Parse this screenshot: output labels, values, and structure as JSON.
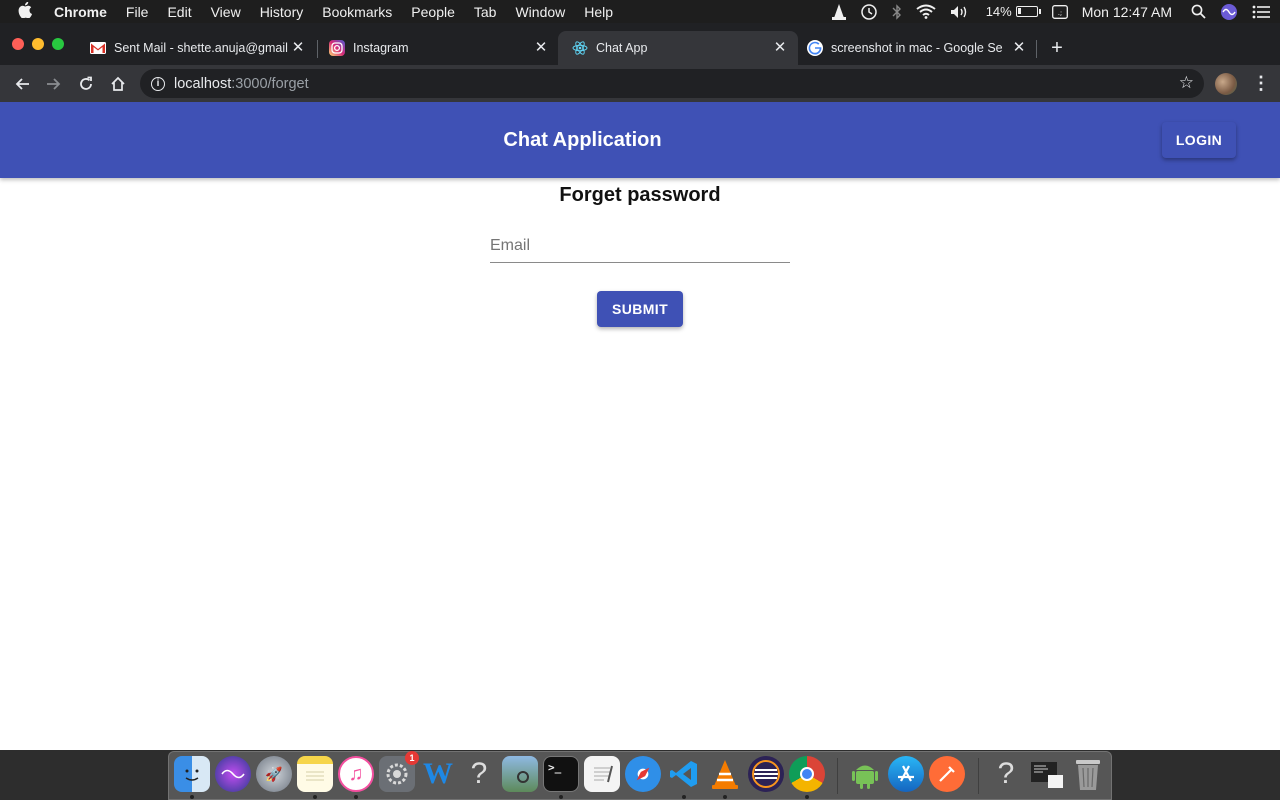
{
  "menubar": {
    "items": [
      "Chrome",
      "File",
      "Edit",
      "View",
      "History",
      "Bookmarks",
      "People",
      "Tab",
      "Window",
      "Help"
    ],
    "battery": "14%",
    "clock": "Mon 12:47 AM"
  },
  "tabs": [
    {
      "title": "Sent Mail - shette.anuja@gmail",
      "favicon": "gmail-icon"
    },
    {
      "title": "Instagram",
      "favicon": "instagram-icon"
    },
    {
      "title": "Chat App",
      "favicon": "react-icon",
      "active": true
    },
    {
      "title": "screenshot in mac - Google Se",
      "favicon": "google-icon"
    }
  ],
  "omnibox": {
    "host": "localhost",
    "path": ":3000/forget"
  },
  "app": {
    "title": "Chat Application",
    "login_label": "LOGIN",
    "form_title": "Forget password",
    "email_placeholder": "Email",
    "submit_label": "SUBMIT",
    "primary_color": "#3f51b5"
  },
  "dock": {
    "items": [
      "finder-icon",
      "siri-icon",
      "launchpad-icon",
      "notes-icon",
      "itunes-icon",
      "system-preferences-icon",
      "word-icon",
      "unknown-app-icon",
      "preview-icon",
      "terminal-icon",
      "textedit-icon",
      "safari-icon",
      "vscode-icon",
      "vlc-icon",
      "eclipse-icon",
      "chrome-icon",
      "android-studio-icon",
      "app-store-icon",
      "postman-icon",
      "unknown-app-icon",
      "screenshot-icon",
      "trash-icon"
    ],
    "badge": "1"
  }
}
